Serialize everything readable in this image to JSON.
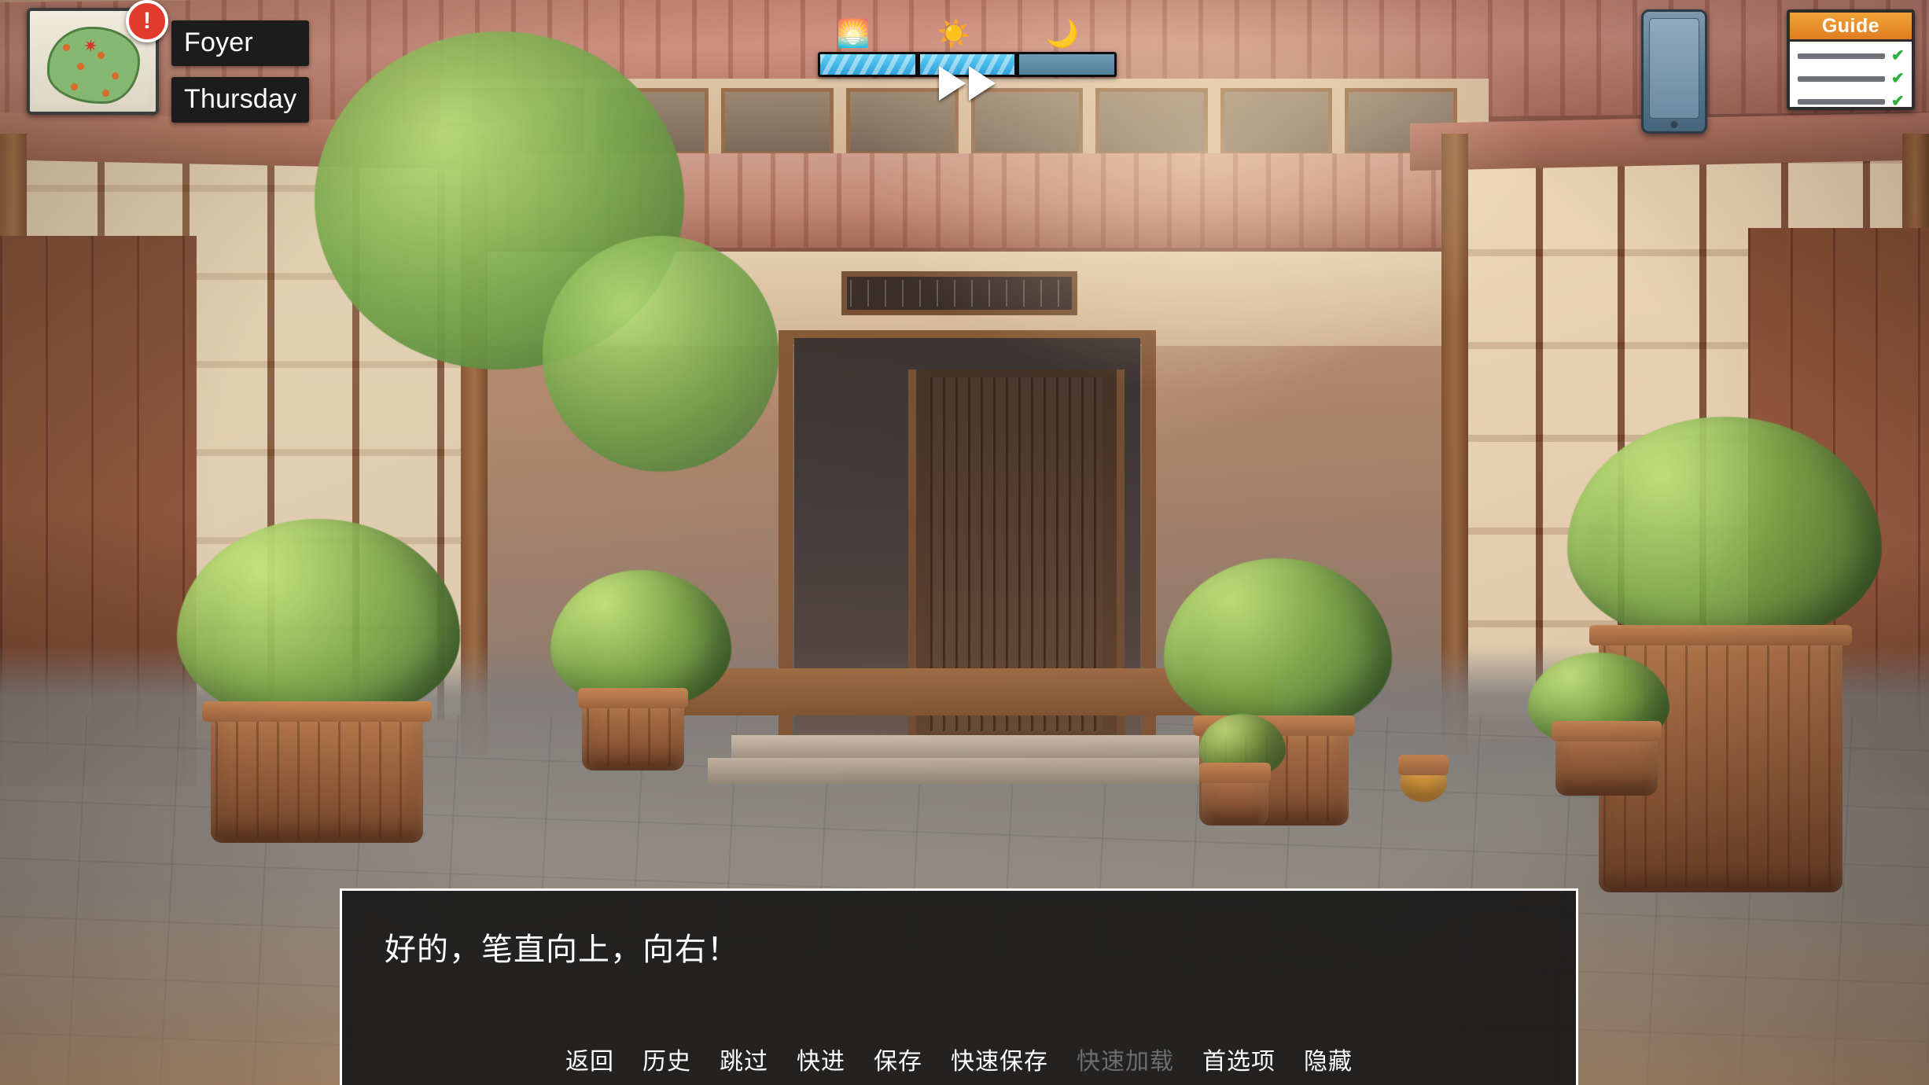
{
  "hud": {
    "map": {
      "name": "map-widget",
      "alert_badge": "!"
    },
    "location_label": "Foyer",
    "day_label": "Thursday",
    "timebar": {
      "icons": [
        "sunrise-icon",
        "sun-icon",
        "moon-icon"
      ],
      "segments": [
        {
          "state": "active"
        },
        {
          "state": "active"
        },
        {
          "state": "inactive"
        }
      ],
      "fast_forward": "fast-forward-icon"
    },
    "phone_button": "phone-icon",
    "guide_button": {
      "title": "Guide",
      "rows": [
        {
          "check": "✔"
        },
        {
          "check": "✔"
        },
        {
          "check": "✔"
        },
        {
          "check": "✔"
        }
      ]
    }
  },
  "dialogue": {
    "text": "好的，笔直向上，向右！",
    "menu": [
      {
        "label": "返回",
        "enabled": true
      },
      {
        "label": "历史",
        "enabled": true
      },
      {
        "label": "跳过",
        "enabled": true
      },
      {
        "label": "快进",
        "enabled": true
      },
      {
        "label": "保存",
        "enabled": true
      },
      {
        "label": "快速保存",
        "enabled": true
      },
      {
        "label": "快速加载",
        "enabled": false
      },
      {
        "label": "首选项",
        "enabled": true
      },
      {
        "label": "隐藏",
        "enabled": true
      }
    ]
  },
  "colors": {
    "alert_red": "#e23b2e",
    "guide_orange": "#e07c1f",
    "timebar_blue": "#2f9fdc",
    "dialogue_bg": "#1a1a1a",
    "disabled_text": "#6d6d6d"
  }
}
